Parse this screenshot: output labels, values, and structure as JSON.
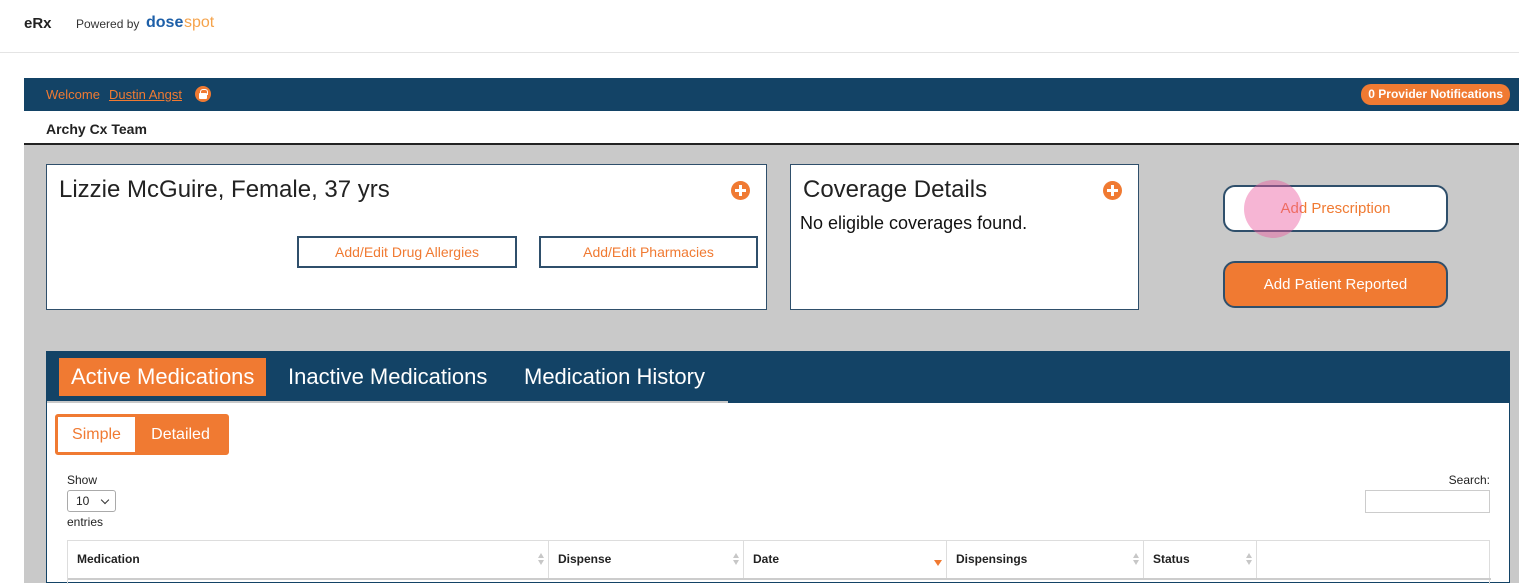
{
  "header": {
    "app_title": "eRx",
    "powered_by": "Powered by",
    "brand_part1": "dose",
    "brand_part2": "spot"
  },
  "welcome_bar": {
    "welcome_text": "Welcome",
    "user_name": "Dustin Angst",
    "notifications": "0 Provider Notifications"
  },
  "team": {
    "name": "Archy Cx Team"
  },
  "patient": {
    "summary": "Lizzie McGuire, Female, 37 yrs",
    "allergies_button": "Add/Edit Drug Allergies",
    "pharmacies_button": "Add/Edit Pharmacies"
  },
  "coverage": {
    "title": "Coverage Details",
    "message": "No eligible coverages found."
  },
  "actions": {
    "add_prescription": "Add Prescription",
    "add_patient_reported": "Add Patient Reported"
  },
  "tabs": [
    {
      "label": "Active Medications",
      "active": true
    },
    {
      "label": "Inactive Medications",
      "active": false
    },
    {
      "label": "Medication History",
      "active": false
    }
  ],
  "view_toggle": {
    "simple": "Simple",
    "detailed": "Detailed",
    "selected": "Detailed"
  },
  "table_controls": {
    "show_label": "Show",
    "page_size": "10",
    "entries_label": "entries",
    "search_label": "Search:",
    "search_value": ""
  },
  "table": {
    "columns": [
      "Medication",
      "Dispense",
      "Date",
      "Dispensings",
      "Status",
      ""
    ],
    "sorted_column": "Date",
    "sort_direction": "descending"
  },
  "colors": {
    "navy": "#134366",
    "accent_orange": "#f07a32",
    "background_gray": "#c9c9c9"
  }
}
